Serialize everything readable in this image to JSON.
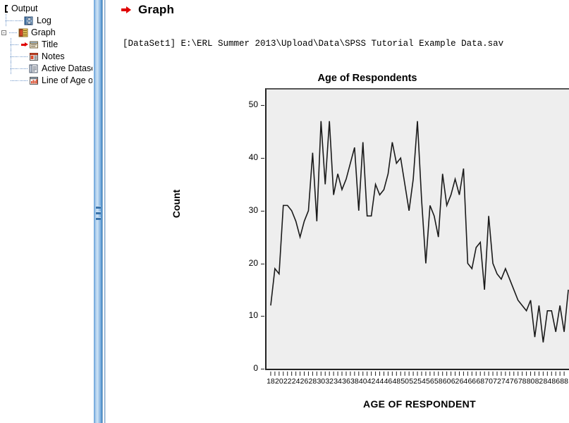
{
  "outline": {
    "title": "Output",
    "items": [
      {
        "label": "Output",
        "icon": "output-root-icon",
        "level": 0,
        "expanded": true,
        "selected": false
      },
      {
        "label": "Log",
        "icon": "log-icon",
        "level": 1,
        "expanded": false,
        "selected": false
      },
      {
        "label": "Graph",
        "icon": "graph-book-icon",
        "level": 1,
        "expanded": true,
        "selected": false
      },
      {
        "label": "Title",
        "icon": "title-icon",
        "level": 2,
        "expanded": false,
        "selected": true
      },
      {
        "label": "Notes",
        "icon": "notes-icon",
        "level": 2,
        "expanded": false,
        "selected": false
      },
      {
        "label": "Active Dataset",
        "icon": "dataset-icon",
        "level": 2,
        "expanded": false,
        "selected": false
      },
      {
        "label": "Line of Age of",
        "icon": "chart-icon",
        "level": 2,
        "expanded": false,
        "selected": false
      }
    ]
  },
  "output": {
    "heading": "Graph",
    "dataset_line": "[DataSet1] E:\\ERL Summer 2013\\Upload\\Data\\SPSS Tutorial Example Data.sav"
  },
  "chart_data": {
    "type": "line",
    "title": "Age of Respondents",
    "xlabel": "AGE OF RESPONDENT",
    "ylabel": "Count",
    "xlim": [
      17,
      90
    ],
    "ylim": [
      0,
      53
    ],
    "yticks": [
      0,
      10,
      20,
      30,
      40,
      50
    ],
    "xtick_labels": [
      18,
      20,
      22,
      24,
      26,
      28,
      30,
      32,
      34,
      36,
      38,
      40,
      42,
      44,
      46,
      48,
      50,
      52,
      54,
      56,
      58,
      60,
      62,
      64,
      66,
      68,
      70,
      72,
      74,
      76,
      78,
      80,
      82,
      84,
      86,
      88
    ],
    "xtick_step_minor": 1,
    "grid": false,
    "legend": false,
    "line_color": "#1a1a1a",
    "plot_background": "#eeeeee",
    "x": [
      18,
      19,
      20,
      21,
      22,
      23,
      24,
      25,
      26,
      27,
      28,
      29,
      30,
      31,
      32,
      33,
      34,
      35,
      36,
      37,
      38,
      39,
      40,
      41,
      42,
      43,
      44,
      45,
      46,
      47,
      48,
      49,
      50,
      51,
      52,
      53,
      54,
      55,
      56,
      57,
      58,
      59,
      60,
      61,
      62,
      63,
      64,
      65,
      66,
      67,
      68,
      69,
      70,
      71,
      72,
      73,
      74,
      75,
      76,
      77,
      78,
      79,
      80,
      81,
      82,
      83,
      84,
      85,
      86,
      87,
      88,
      89
    ],
    "values": [
      12,
      19,
      18,
      31,
      31,
      30,
      28,
      25,
      28,
      30,
      41,
      28,
      47,
      35,
      47,
      33,
      37,
      34,
      36,
      39,
      42,
      30,
      43,
      29,
      29,
      35,
      33,
      34,
      37,
      43,
      39,
      40,
      35,
      30,
      36,
      47,
      32,
      20,
      31,
      29,
      25,
      37,
      31,
      33,
      36,
      33,
      38,
      20,
      19,
      23,
      24,
      15,
      29,
      20,
      18,
      17,
      19,
      17,
      15,
      13,
      12,
      11,
      13,
      6,
      12,
      5,
      11,
      11,
      7,
      12,
      7,
      15
    ]
  }
}
